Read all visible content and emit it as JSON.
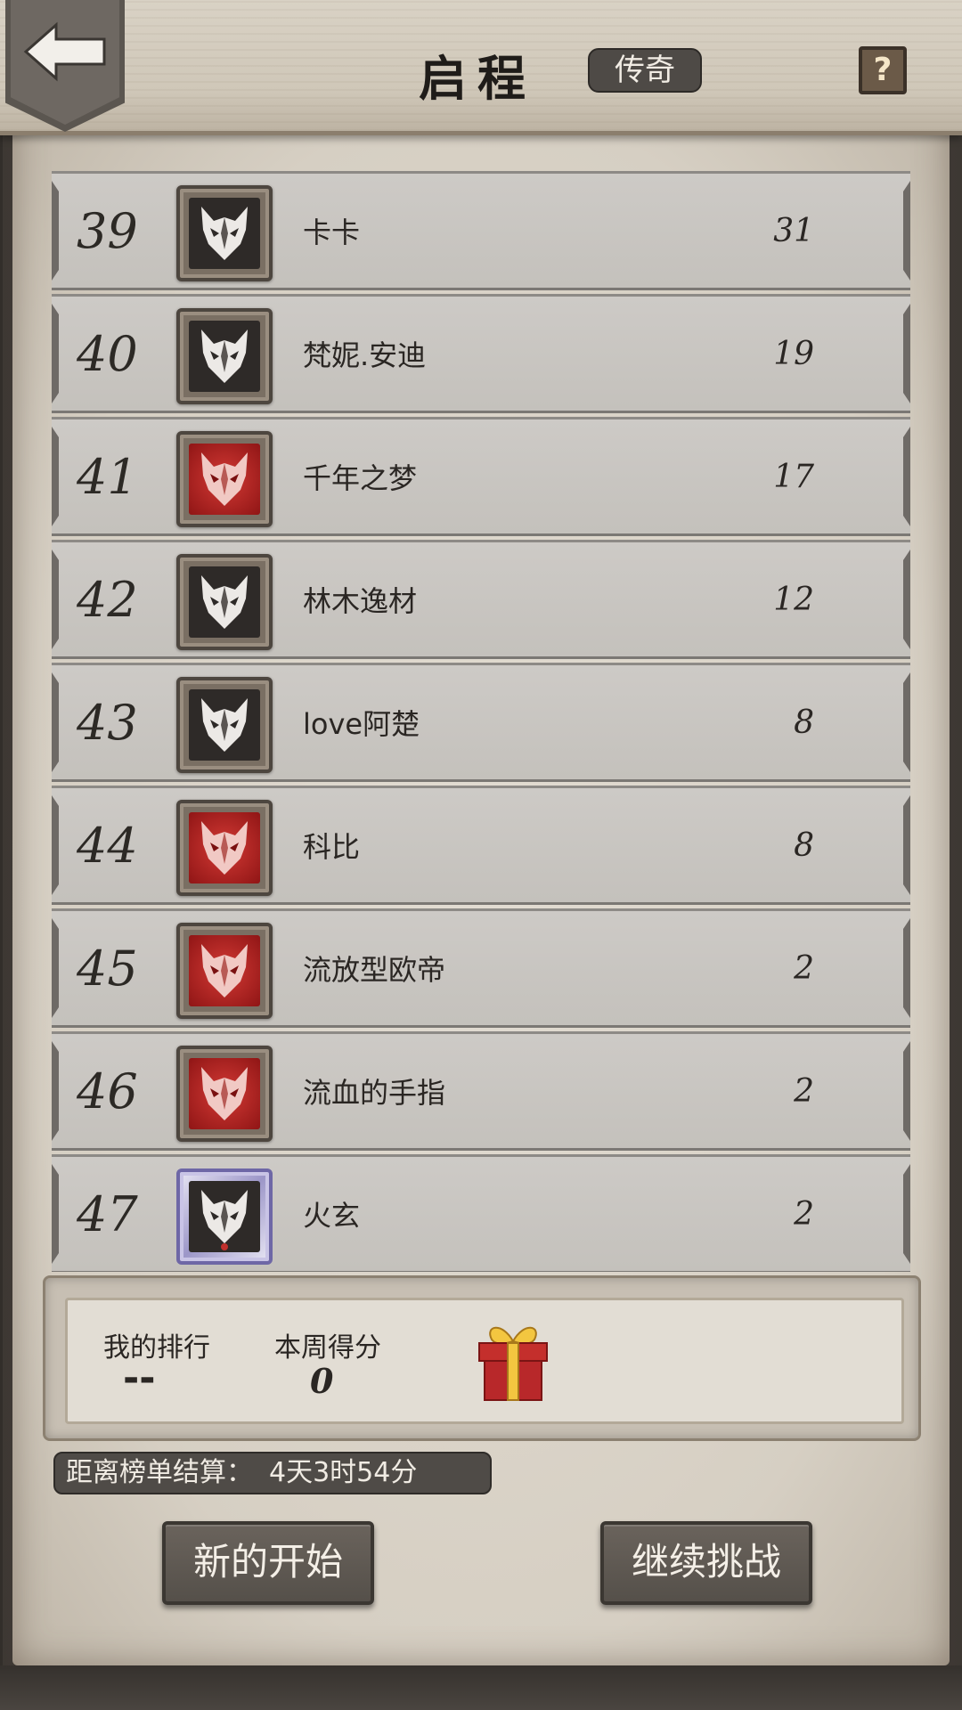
{
  "header": {
    "title": "启程",
    "mode": "传奇",
    "help": "?"
  },
  "leaderboard": [
    {
      "rank": "39",
      "name": "卡卡",
      "score": "31",
      "avatar": "black-wolf"
    },
    {
      "rank": "40",
      "name": "梵妮.安迪",
      "score": "19",
      "avatar": "black-wolf"
    },
    {
      "rank": "41",
      "name": "千年之梦",
      "score": "17",
      "avatar": "red-wolf"
    },
    {
      "rank": "42",
      "name": "林木逸材",
      "score": "12",
      "avatar": "black-wolf"
    },
    {
      "rank": "43",
      "name": "love阿楚",
      "score": "8",
      "avatar": "black-wolf"
    },
    {
      "rank": "44",
      "name": "科比",
      "score": "8",
      "avatar": "red-wolf"
    },
    {
      "rank": "45",
      "name": "流放型欧帝",
      "score": "2",
      "avatar": "red-wolf"
    },
    {
      "rank": "46",
      "name": "流血的手指",
      "score": "2",
      "avatar": "red-wolf"
    },
    {
      "rank": "47",
      "name": "火玄",
      "score": "2",
      "avatar": "black-wolf-purple-frame"
    }
  ],
  "my_stats": {
    "rank_label": "我的排行",
    "rank_value": "--",
    "score_label": "本周得分",
    "score_value": "0",
    "reward_icon": "gift-box-icon"
  },
  "countdown": {
    "label": "距离榜单结算：",
    "value": "4天3时54分"
  },
  "buttons": {
    "new_start": "新的开始",
    "continue": "继续挑战"
  },
  "colors": {
    "red_avatar": "#c0302c",
    "black_avatar": "#2e2a28",
    "row_bg": "#c9c6c1"
  }
}
